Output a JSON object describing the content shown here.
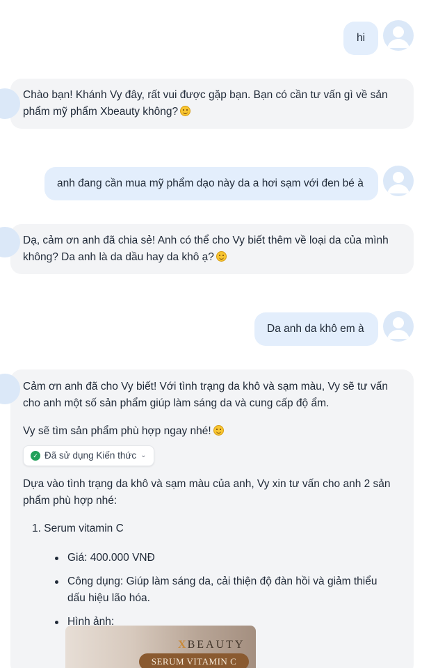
{
  "messages": [
    {
      "role": "user",
      "text": "hi"
    },
    {
      "role": "bot",
      "lines": [
        "Chào bạn! Khánh Vy đây, rất vui được gặp bạn. Bạn có cần tư vấn gì về sản",
        "phẩm mỹ phẩm Xbeauty không?"
      ],
      "emoji": "smiling-face"
    },
    {
      "role": "user",
      "text": "anh đang cần mua mỹ phẩm dạo này da a hơi sạm với đen bé à"
    },
    {
      "role": "bot",
      "lines": [
        "Dạ, cảm ơn anh đã chia sẻ! Anh có thể cho Vy biết thêm về loại da của mình",
        "không? Da anh là da dầu hay da khô ạ?"
      ],
      "emoji": "smiling-face"
    },
    {
      "role": "user",
      "text": "Da anh da khô em à"
    }
  ],
  "reply": {
    "intro_lines": [
      "Cảm ơn anh đã cho Vy biết! Với tình trạng da khô và sạm màu, Vy sẽ tư vấn",
      "cho anh một số sản phẩm giúp làm sáng da và cung cấp độ ẩm."
    ],
    "searching": "Vy sẽ tìm sản phẩm phù hợp ngay nhé!",
    "knowledge_chip": "Đã sử dụng Kiến thức",
    "advice_lines": [
      "Dựa vào tình trạng da khô và sạm màu của anh, Vy xin tư vấn cho anh 2 sản",
      "phẩm phù hợp nhé:"
    ],
    "product": {
      "title": "1. Serum vitamin C",
      "price": "Giá: 400.000 VNĐ",
      "usage_lines": [
        "Công dụng: Giúp làm sáng da, cải thiện độ đàn hồi và giảm thiểu",
        "dấu hiệu lão hóa."
      ],
      "image_label": "Hình ảnh:",
      "image": {
        "brand": "BEAUTY",
        "brand_prefix": "X",
        "tag": "SERUM VITAMIN C"
      }
    }
  },
  "colors": {
    "user_bubble": "#e3eefc",
    "bot_bubble": "#f3f4f6",
    "avatar": "#dbe8f8",
    "check": "#22a05a"
  }
}
